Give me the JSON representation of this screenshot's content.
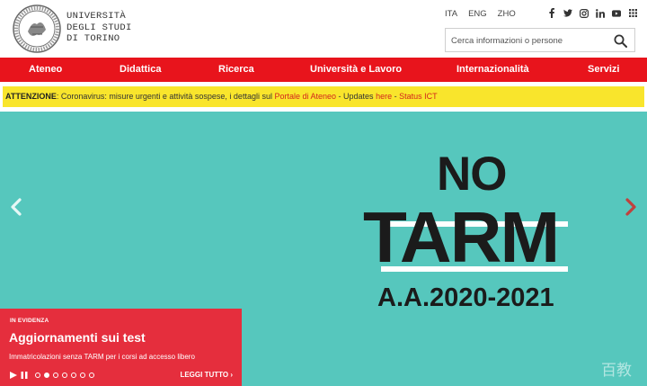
{
  "header": {
    "university_name_lines": [
      "UNIVERSITÀ",
      "DEGLI STUDI",
      "DI TORINO"
    ],
    "languages": [
      "ITA",
      "ENG",
      "ZHO"
    ],
    "social_icons": [
      "facebook-icon",
      "twitter-icon",
      "instagram-icon",
      "linkedin-icon",
      "youtube-icon",
      "grid-icon"
    ],
    "search_placeholder": "Cerca informazioni o persone"
  },
  "nav": {
    "items": [
      "Ateneo",
      "Didattica",
      "Ricerca",
      "Università e Lavoro",
      "Internazionalità",
      "Servizi"
    ]
  },
  "alert": {
    "label": "ATTENZIONE",
    "text": ": Coronavirus: misure urgenti e attività sospese, i dettagli sul ",
    "link1": "Portale di Ateneo",
    "text2": " - Updates ",
    "link2": "here",
    "text3": " - ",
    "link3": "Status ICT"
  },
  "hero": {
    "poster": {
      "line1": "NO",
      "line2": "TARM",
      "line3": "A.A.2020-2021"
    },
    "card": {
      "kicker": "IN EVIDENZA",
      "title": "Aggiornamenti sui test",
      "subtitle": "Immatricolazioni senza TARM per i corsi ad accesso libero",
      "more": "LEGGI TUTTO",
      "slide_count": 7,
      "active_slide": 2
    },
    "watermark": "百教"
  },
  "colors": {
    "brand_red": "#e8141c",
    "alert_yellow": "#f9e52c",
    "hero_teal": "#56c7bd",
    "card_red": "#e52e3d"
  }
}
